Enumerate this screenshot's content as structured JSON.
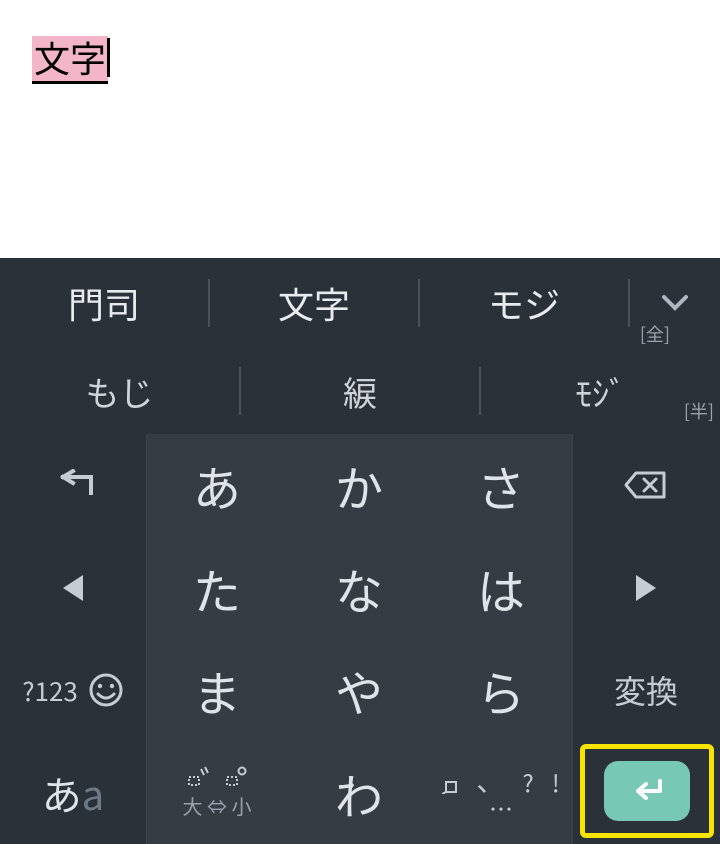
{
  "input": {
    "composing": "文字"
  },
  "candidates": {
    "top": [
      "門司",
      "文字",
      "モジ"
    ],
    "bottom": [
      "もじ",
      "綟",
      "ﾓｼﾞ"
    ],
    "badge_full": "[全]",
    "badge_half": "[半]",
    "expand_icon": "⌄"
  },
  "keys": {
    "row1": [
      "あ",
      "か",
      "さ"
    ],
    "row2": [
      "た",
      "な",
      "は"
    ],
    "row3": [
      "ま",
      "や",
      "ら"
    ],
    "row4_center": "わ",
    "func": {
      "undo": "←",
      "left": "◀",
      "symnum": "?123",
      "lang": "あa",
      "delete": "⌫",
      "right": "▶",
      "henkan": "変換",
      "enter": "⏎",
      "dakuten_small": "大 ⇔ 小",
      "punct_q": "?",
      "punct_ex": "!",
      "punct_ellipsis": "…"
    }
  }
}
